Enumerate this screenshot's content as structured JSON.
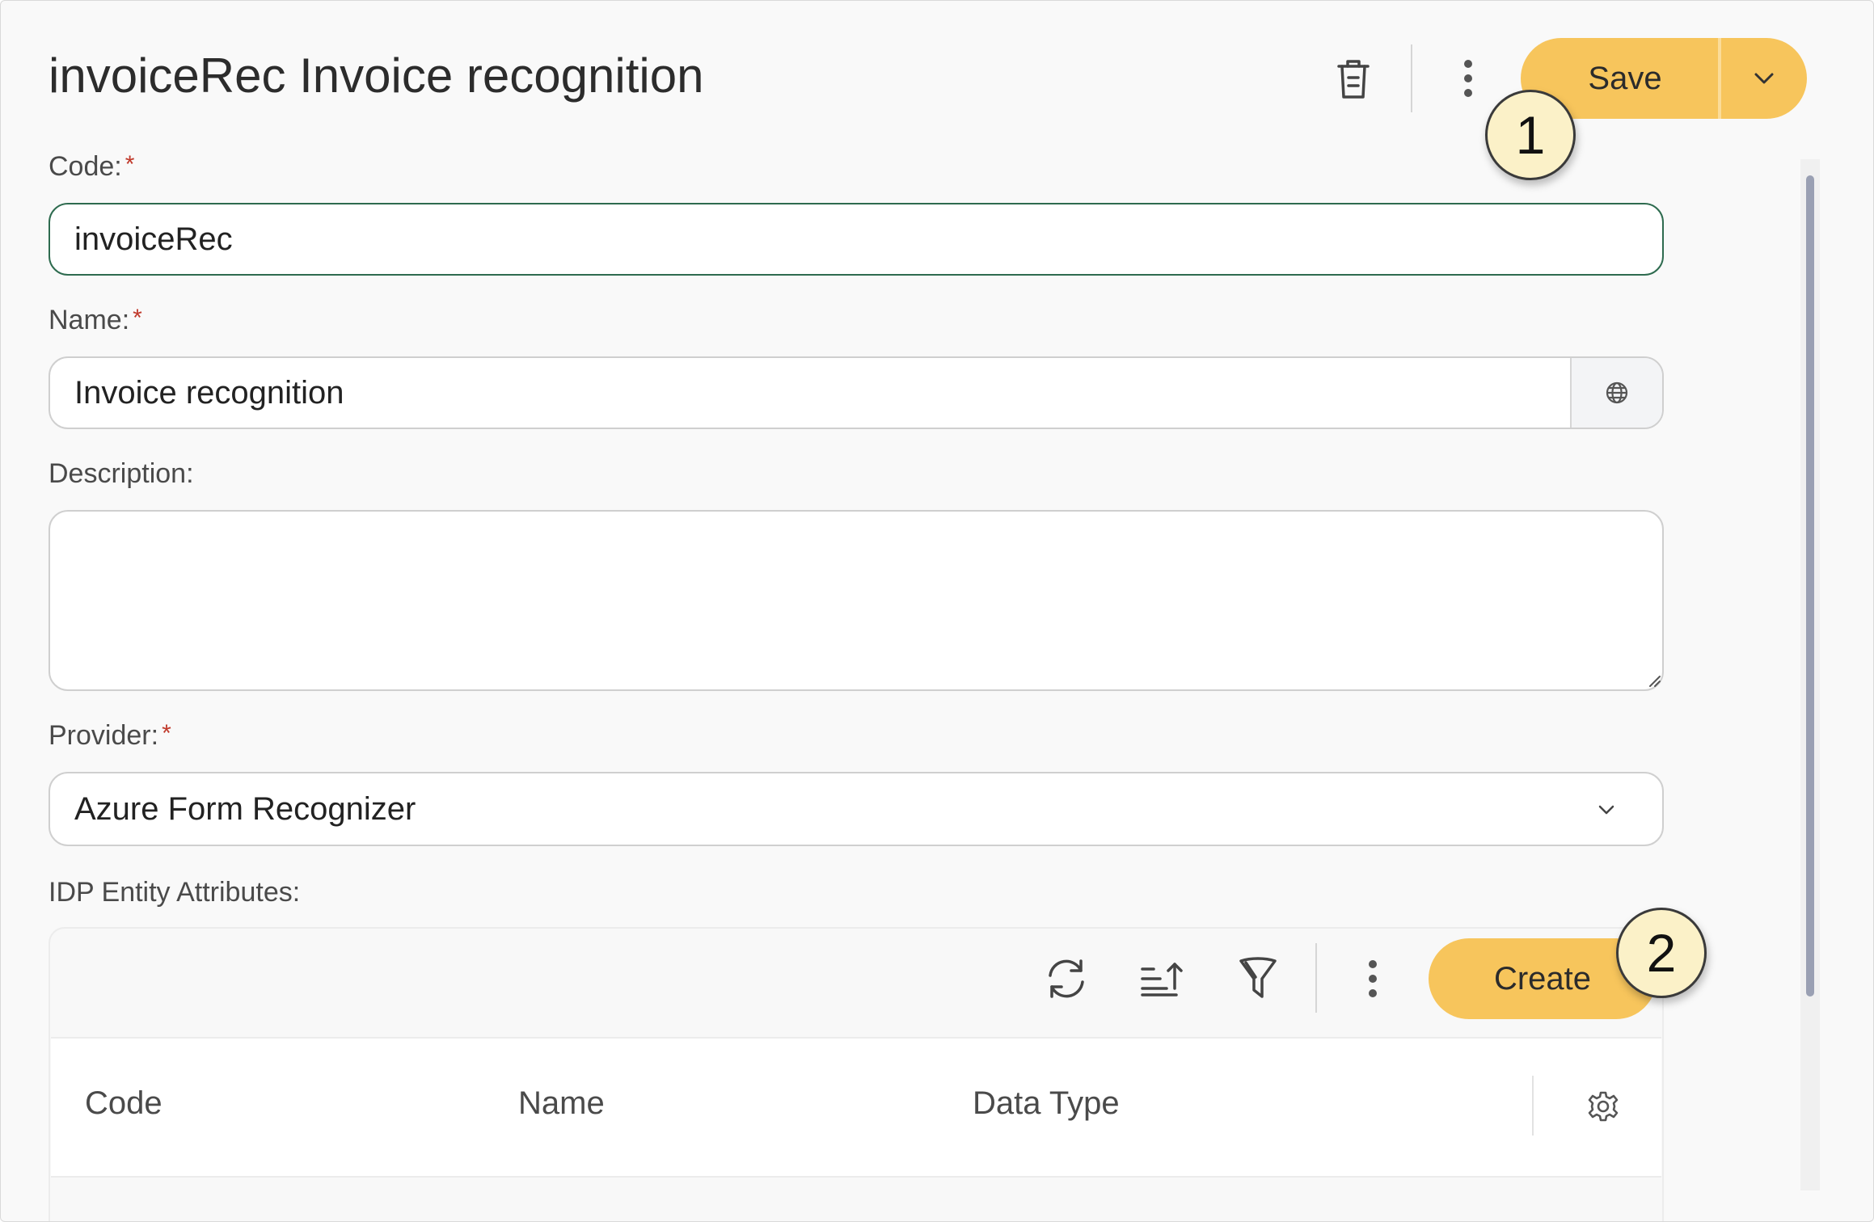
{
  "header": {
    "title": "invoiceRec Invoice recognition",
    "delete_icon": "trash-icon",
    "more_icon": "kebab-vertical-icon",
    "save_label": "Save",
    "save_dropdown_icon": "chevron-down-icon"
  },
  "callouts": {
    "one": "1",
    "two": "2"
  },
  "form": {
    "code": {
      "label": "Code:",
      "required_mark": "*",
      "value": "invoiceRec"
    },
    "name": {
      "label": "Name:",
      "required_mark": "*",
      "value": "Invoice recognition",
      "translate_icon": "globe-icon"
    },
    "description": {
      "label": "Description:",
      "value": ""
    },
    "provider": {
      "label": "Provider:",
      "required_mark": "*",
      "value": "Azure Form Recognizer",
      "dropdown_icon": "chevron-down-icon"
    },
    "attributes": {
      "label": "IDP Entity Attributes:"
    }
  },
  "grid": {
    "toolbar": {
      "refresh_icon": "refresh-icon",
      "sort_icon": "sort-ascending-icon",
      "filter_icon": "filter-icon",
      "more_icon": "kebab-vertical-icon",
      "create_label": "Create"
    },
    "columns": [
      "Code",
      "Name",
      "Data Type"
    ],
    "settings_icon": "gear-icon"
  },
  "colors": {
    "accent": "#f7c55c",
    "focus_border": "#2e6b4f",
    "required": "#c0392b"
  }
}
